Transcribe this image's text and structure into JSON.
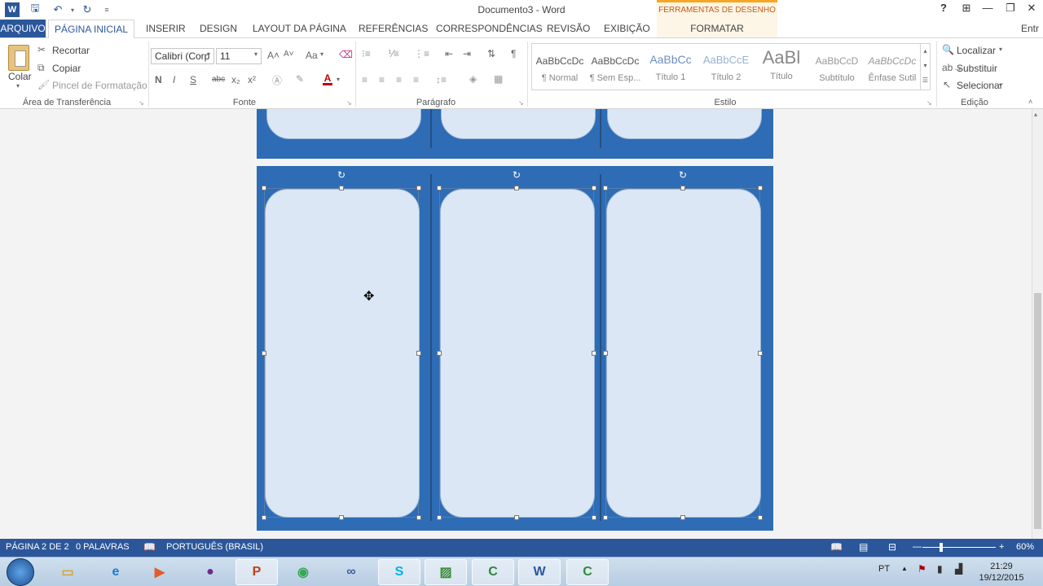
{
  "titlebar": {
    "title": "Documento3 - Word",
    "tools_header": "FERRAMENTAS DE DESENHO",
    "help": "?",
    "restore_ribbon": "⊞",
    "minimize": "—",
    "maximize": "❐",
    "close": "✕"
  },
  "tabs": {
    "arquivo": "ARQUIVO",
    "home": "PÁGINA INICIAL",
    "inserir": "INSERIR",
    "design": "DESIGN",
    "layout": "LAYOUT DA PÁGINA",
    "referencias": "REFERÊNCIAS",
    "correspondencias": "CORRESPONDÊNCIAS",
    "revisao": "REVISÃO",
    "exibicao": "EXIBIÇÃO",
    "formatar": "FORMATAR",
    "entrar": "Entr"
  },
  "ribbon": {
    "clipboard": {
      "paste": "Colar",
      "cut": "Recortar",
      "copy": "Copiar",
      "format_painter": "Pincel de Formatação",
      "label": "Área de Transferência"
    },
    "font": {
      "font_name": "Calibri (Corp",
      "font_size": "11",
      "grow": "A˄",
      "shrink": "A˅",
      "case": "Aa",
      "bold": "N",
      "italic": "I",
      "underline": "S",
      "strike": "abc",
      "subscript": "x₂",
      "superscript": "x²",
      "font_color": "A",
      "label": "Fonte"
    },
    "paragraph": {
      "label": "Parágrafo",
      "pilcrow": "¶"
    },
    "styles": {
      "label": "Estilo",
      "items": [
        {
          "preview": "AaBbCcDc",
          "name": "¶ Normal"
        },
        {
          "preview": "AaBbCcDc",
          "name": "¶ Sem Esp..."
        },
        {
          "preview": "AaBbCc",
          "name": "Título 1"
        },
        {
          "preview": "AaBbCcE",
          "name": "Título 2"
        },
        {
          "preview": "AaBl",
          "name": "Título"
        },
        {
          "preview": "AaBbCcD",
          "name": "Subtítulo"
        },
        {
          "preview": "AaBbCcDc",
          "name": "Ênfase Sutil"
        }
      ]
    },
    "editing": {
      "find": "Localizar",
      "replace": "Substituir",
      "select": "Selecionar",
      "label": "Edição"
    }
  },
  "statusbar": {
    "page": "PÁGINA 2 DE 2",
    "words": "0 PALAVRAS",
    "language": "PORTUGUÊS (BRASIL)",
    "zoom": "60%"
  },
  "taskbar": {
    "lang": "PT",
    "time": "21:29",
    "date": "19/12/2015"
  },
  "colors": {
    "word_blue": "#2b579a",
    "shape_blue": "#2e6cb5",
    "panel_fill": "#dbe7f4",
    "tools_orange": "#f6a623"
  }
}
